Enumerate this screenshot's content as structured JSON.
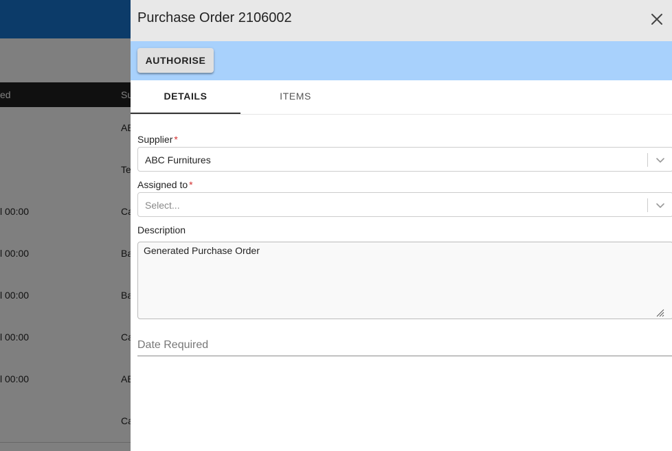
{
  "background": {
    "table_header": {
      "col_ordered": "ed",
      "col_supplier": "Su"
    },
    "rows": [
      {
        "date": "",
        "supplier": "AB"
      },
      {
        "date": "",
        "supplier": "Te"
      },
      {
        "date": "l 00:00",
        "supplier": "Ca"
      },
      {
        "date": "l 00:00",
        "supplier": "Ba"
      },
      {
        "date": "l 00:00",
        "supplier": "Ba"
      },
      {
        "date": "l 00:00",
        "supplier": "Ca"
      },
      {
        "date": "l 00:00",
        "supplier": "AB"
      },
      {
        "date": "",
        "supplier": "Ca"
      }
    ]
  },
  "drawer": {
    "title": "Purchase Order 2106002",
    "close_icon": "close-icon",
    "actions": {
      "authorise_label": "AUTHORISE"
    },
    "tabs": [
      {
        "label": "DETAILS",
        "active": true
      },
      {
        "label": "ITEMS",
        "active": false
      }
    ],
    "form": {
      "supplier": {
        "label": "Supplier",
        "required_mark": "*",
        "value": "ABC Furnitures"
      },
      "assigned_to": {
        "label": "Assigned to",
        "required_mark": "*",
        "placeholder": "Select..."
      },
      "description": {
        "label": "Description",
        "value": "Generated Purchase Order"
      },
      "date_required": {
        "placeholder": "Date Required"
      }
    }
  },
  "colors": {
    "action_bar": "#a8d1fc",
    "header_bg": "#e8e8e8",
    "required": "#d32f2f",
    "overlay": "rgba(0,0,0,0.5)"
  }
}
